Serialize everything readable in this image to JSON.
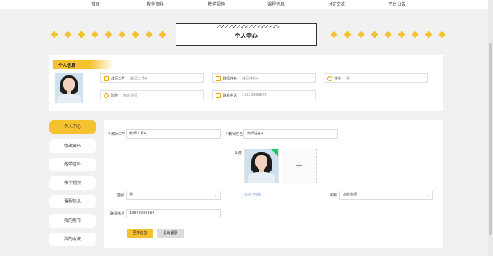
{
  "nav": {
    "items": [
      "首页",
      "教学资料",
      "教学视频",
      "课程信息",
      "讨论交流",
      "平台公告"
    ]
  },
  "page_title": "个人中心",
  "info_card": {
    "header": "个人信息",
    "fields": {
      "teacher_id": {
        "label": "教师工号",
        "value": "教师工号4"
      },
      "teacher_name": {
        "label": "教师姓名",
        "value": "教师姓名4"
      },
      "gender": {
        "label": "性别",
        "value": "男"
      },
      "title": {
        "label": "职称",
        "value": "高级讲师"
      },
      "phone": {
        "label": "联系电话",
        "value": "13823888884"
      }
    }
  },
  "sidebar": {
    "items": [
      "个人中心",
      "修改密码",
      "教学资料",
      "教学视频",
      "课程信息",
      "我的发布",
      "我的收藏"
    ]
  },
  "form": {
    "teacher_id_label": "教师工号",
    "teacher_id_value": "教师工号4",
    "teacher_name_label": "教师姓名",
    "teacher_name_value": "教师姓名4",
    "avatar_label": "头像",
    "upload_hint": "点击上传头像",
    "gender_label": "性别",
    "gender_value": "男",
    "title_label": "职称",
    "title_value": "高级讲师",
    "phone_label": "联系电话",
    "phone_value": "13823888884",
    "update_button": "更新信息",
    "logout_button": "退出登录"
  },
  "colors": {
    "accent": "#f5c12e",
    "success": "#13ce66"
  }
}
